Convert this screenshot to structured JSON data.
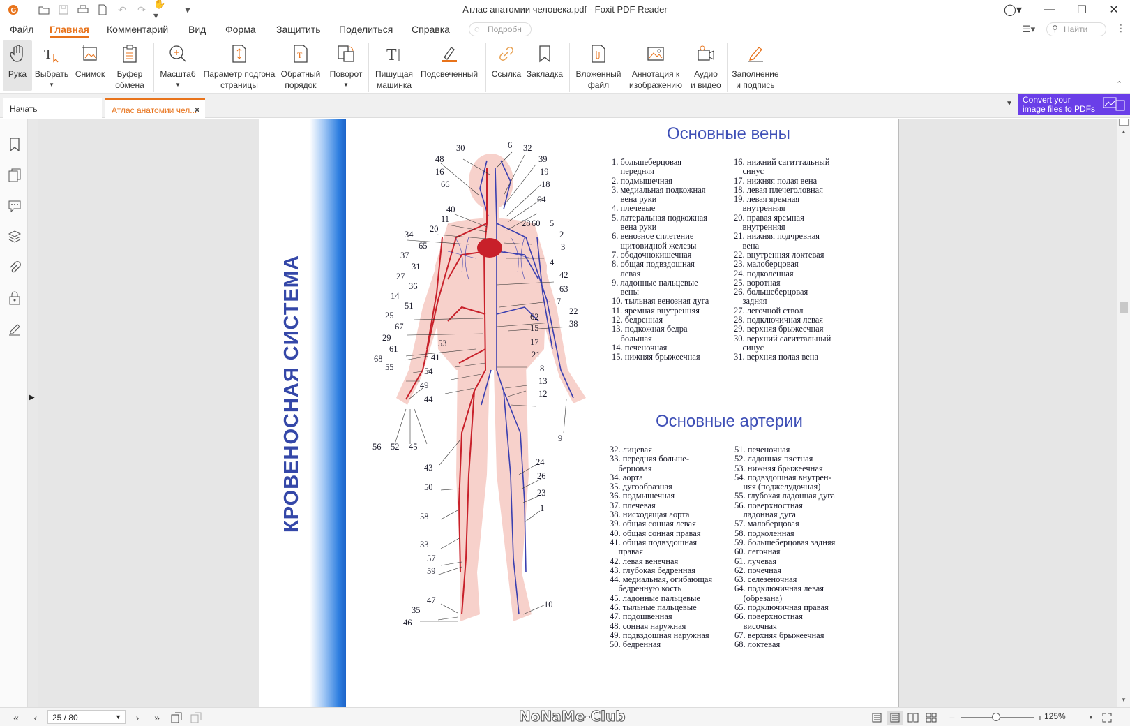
{
  "app": {
    "title": "Атлас анатомии человека.pdf - Foxit PDF Reader"
  },
  "menu": [
    "Файл",
    "Главная",
    "Комментарий",
    "Вид",
    "Форма",
    "Защитить",
    "Поделиться",
    "Справка"
  ],
  "tell_me_placeholder": "Подробн",
  "search_placeholder": "Найти",
  "ribbon": {
    "hand": "Рука",
    "select": "Выбрать",
    "snapshot": "Снимок",
    "clipboard": "Буфер\nобмена",
    "zoom": "Масштаб",
    "fit": "Параметр подгона\nстраницы",
    "reverse": "Обратный\nпорядок",
    "rotate": "Поворот",
    "typewriter": "Пишущая\nмашинка",
    "highlight": "Подсвеченный",
    "link": "Ссылка",
    "bookmark": "Закладка",
    "attachment": "Вложенный\nфайл",
    "image_annot": "Аннотация к\nизображению",
    "audio": "Аудио\nи видео",
    "fill_sign": "Заполнение\nи подпись"
  },
  "tabs": {
    "start": "Начать",
    "doc": "Атлас анатомии чел..."
  },
  "promo": "Convert your\nimage files to PDFs",
  "page": {
    "vertical_title": "КРОВЕНОСНАЯ СИСТЕМА",
    "veins_title": "Основные вены",
    "arteries_title": "Основные артерии",
    "veins_col1": [
      "1. большеберцовая",
      "    передняя",
      "2. подмышечная",
      "3. медиальная подкожная",
      "    вена руки",
      "4. плечевые",
      "5. латеральная подкожная",
      "    вена руки",
      "6. венозное сплетение",
      "    щитовидной железы",
      "7. ободочнокишечная",
      "8. общая подвздошная",
      "    левая",
      "9. ладонные пальцевые",
      "    вены",
      "10. тыльная венозная дуга",
      "11. яремная внутренняя",
      "12. бедренная",
      "13. подкожная бедра",
      "    большая",
      "14. печеночная",
      "15. нижняя брыжеечная"
    ],
    "veins_col2": [
      "16. нижний сагиттальный",
      "    синус",
      "17. нижняя полая вена",
      "18. левая плечеголовная",
      "19. левая яремная",
      "    внутренняя",
      "20. правая яремная",
      "    внутренняя",
      "21. нижняя подчревная",
      "    вена",
      "22. внутренняя локтевая",
      "23. малоберцовая",
      "24. подколенная",
      "25. воротная",
      "26. большеберцовая",
      "    задняя",
      "27. легочной ствол",
      "28. подключичная левая",
      "29. верхняя брыжеечная",
      "30. верхний сагиттальный",
      "    синус",
      "31. верхняя полая вена"
    ],
    "arteries_col1": [
      "32. лицевая",
      "33. передняя больше-",
      "    берцовая",
      "34. аорта",
      "35. дугообразная",
      "36. подмышечная",
      "37. плечевая",
      "38. нисходящая аорта",
      "39. общая сонная левая",
      "40. общая сонная правая",
      "41. общая подвздошная",
      "    правая",
      "42. левая венечная",
      "43. глубокая бедренная",
      "44. медиальная, огибающая",
      "    бедренную кость",
      "45. ладонные пальцевые",
      "46. тыльные пальцевые",
      "47. подошвенная",
      "48. сонная наружная",
      "49. подвздошная наружная",
      "50. бедренная"
    ],
    "arteries_col2": [
      "51. печеночная",
      "52. ладонная пястная",
      "53. нижняя брыжеечная",
      "54. подвздошная внутрен-",
      "    няя (поджелудочная)",
      "55. глубокая ладонная дуга",
      "56. поверхностная",
      "    ладонная дуга",
      "57. малоберцовая",
      "58. подколенная",
      "59. большеберцовая задняя",
      "60. легочная",
      "61. лучевая",
      "62. почечная",
      "63. селезеночная",
      "64. подключичная левая",
      "    (обрезана)",
      "65. подключичная правая",
      "66. поверхностная",
      "    височная",
      "67. верхняя брыжеечная",
      "68. локтевая"
    ]
  },
  "status": {
    "page": "25 / 80",
    "zoom": "125%",
    "watermark": "NoNaMe-Club"
  },
  "colors": {
    "accent": "#e8731b",
    "promo": "#6a3ee8",
    "vein": "#3a3fb0",
    "artery": "#c8202a"
  }
}
